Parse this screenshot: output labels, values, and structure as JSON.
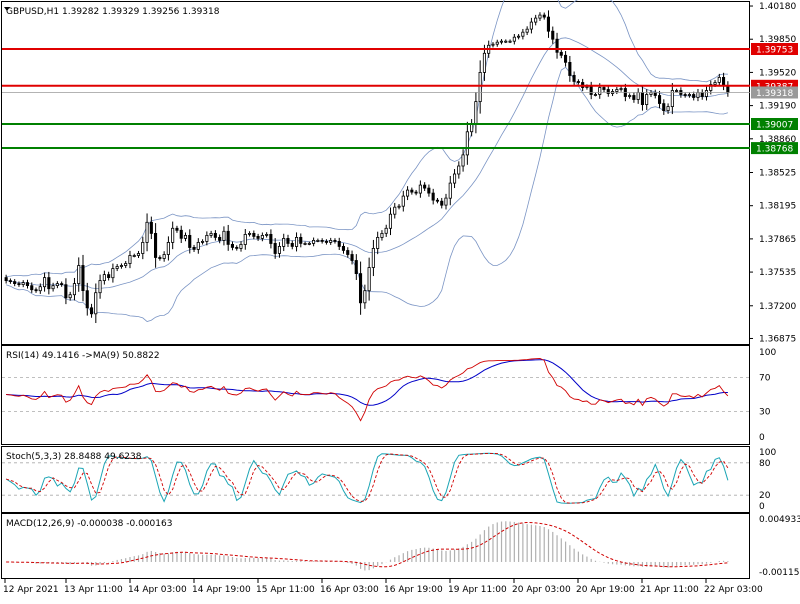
{
  "colors": {
    "resistance": "#e00000",
    "support": "#008000",
    "bull_candle": "#ffffff",
    "bear_candle": "#000000",
    "band": "#7a94c4",
    "rsi": "#d00000",
    "rsi_ma": "#0000c8",
    "stoch_main": "#1ba5b5",
    "stoch_signal": "#d00000",
    "macd_hist": "#b0b0b0",
    "macd_signal": "#d00000",
    "current_price": "#9a9a9a"
  },
  "price_panel": {
    "header": "GBPUSD,H1  1.39282 1.39329 1.39256 1.39318",
    "y_ticks": [
      "1.40180",
      "1.39850",
      "1.39520",
      "1.39190",
      "1.38860",
      "1.38525",
      "1.38195",
      "1.37865",
      "1.37535",
      "1.37200",
      "1.36875"
    ],
    "levels": [
      {
        "label": "1.39753",
        "value": 1.39753,
        "kind": "resistance"
      },
      {
        "label": "1.39387",
        "value": 1.39387,
        "kind": "resistance"
      },
      {
        "label": "1.39007",
        "value": 1.39007,
        "kind": "support"
      },
      {
        "label": "1.38768",
        "value": 1.38768,
        "kind": "support"
      }
    ],
    "current_label": "1.39318"
  },
  "rsi_panel": {
    "header": "RSI(14) 49.1416  ->MA(9) 50.8822",
    "y_ticks": [
      "100",
      "70",
      "30",
      "0"
    ]
  },
  "stoch_panel": {
    "header": "Stoch(5,3,3) 28.8488 49.6238",
    "y_ticks": [
      "100",
      "80",
      "20",
      "0"
    ]
  },
  "macd_panel": {
    "header": "MACD(12,26,9) -0.000038 -0.000163",
    "y_ticks": [
      "0.004933",
      "-0.001151"
    ]
  },
  "x_labels": [
    "12 Apr 2021",
    "13 Apr 11:00",
    "14 Apr 03:00",
    "14 Apr 19:00",
    "15 Apr 11:00",
    "16 Apr 03:00",
    "16 Apr 19:00",
    "19 Apr 11:00",
    "20 Apr 03:00",
    "20 Apr 19:00",
    "21 Apr 11:00",
    "22 Apr 03:00"
  ],
  "chart_data": {
    "type": "line",
    "title": "GBPUSD,H1",
    "xlabel": "",
    "ylabel": "",
    "ylim": [
      1.3682,
      1.4022
    ],
    "series": [
      {
        "values": [
          1.3745,
          1.3744,
          1.3742,
          1.3741,
          1.3743,
          1.374,
          1.3736,
          1.3735,
          1.3739,
          1.3748,
          1.3737,
          1.374,
          1.3742,
          1.3741,
          1.3728,
          1.3731,
          1.3742,
          1.376,
          1.3735,
          1.3718,
          1.3712,
          1.3733,
          1.3745,
          1.3751,
          1.3748,
          1.3757,
          1.3759,
          1.376,
          1.3762,
          1.377,
          1.377,
          1.3772,
          1.3783,
          1.3803,
          1.3792,
          1.3768,
          1.3767,
          1.3771,
          1.3783,
          1.3797,
          1.3795,
          1.3787,
          1.379,
          1.3778,
          1.3776,
          1.3783,
          1.3784,
          1.379,
          1.3792,
          1.3788,
          1.3785,
          1.3794,
          1.3781,
          1.3778,
          1.3777,
          1.3781,
          1.3791,
          1.3792,
          1.3789,
          1.3787,
          1.379,
          1.3791,
          1.3782,
          1.3772,
          1.3779,
          1.3787,
          1.3782,
          1.3779,
          1.3788,
          1.3782,
          1.3782,
          1.3782,
          1.3785,
          1.3785,
          1.3784,
          1.3783,
          1.3785,
          1.3784,
          1.3779,
          1.3775,
          1.3771,
          1.3765,
          1.3752,
          1.3723,
          1.3735,
          1.3758,
          1.3777,
          1.3788,
          1.3792,
          1.3797,
          1.3811,
          1.3818,
          1.3819,
          1.3829,
          1.3835,
          1.3833,
          1.3832,
          1.384,
          1.3837,
          1.3832,
          1.3825,
          1.3824,
          1.382,
          1.3827,
          1.3842,
          1.3851,
          1.3859,
          1.387,
          1.3893,
          1.3901,
          1.3923,
          1.3952,
          1.3971,
          1.3979,
          1.398,
          1.3982,
          1.3983,
          1.3983,
          1.3983,
          1.3987,
          1.3988,
          1.3992,
          1.3995,
          1.4002,
          1.4006,
          1.4009,
          1.4007,
          1.3993,
          1.3985,
          1.3972,
          1.3969,
          1.3962,
          1.3949,
          1.3943,
          1.3942,
          1.3937,
          1.3938,
          1.393,
          1.393,
          1.3937,
          1.3935,
          1.3931,
          1.3933,
          1.3935,
          1.3936,
          1.3928,
          1.3929,
          1.3925,
          1.3932,
          1.392,
          1.393,
          1.3932,
          1.3929,
          1.3921,
          1.3914,
          1.3918,
          1.3934,
          1.3934,
          1.393,
          1.3929,
          1.393,
          1.3927,
          1.3932,
          1.3928,
          1.3934,
          1.394,
          1.3942,
          1.3947,
          1.3939,
          1.3932
        ]
      }
    ]
  }
}
